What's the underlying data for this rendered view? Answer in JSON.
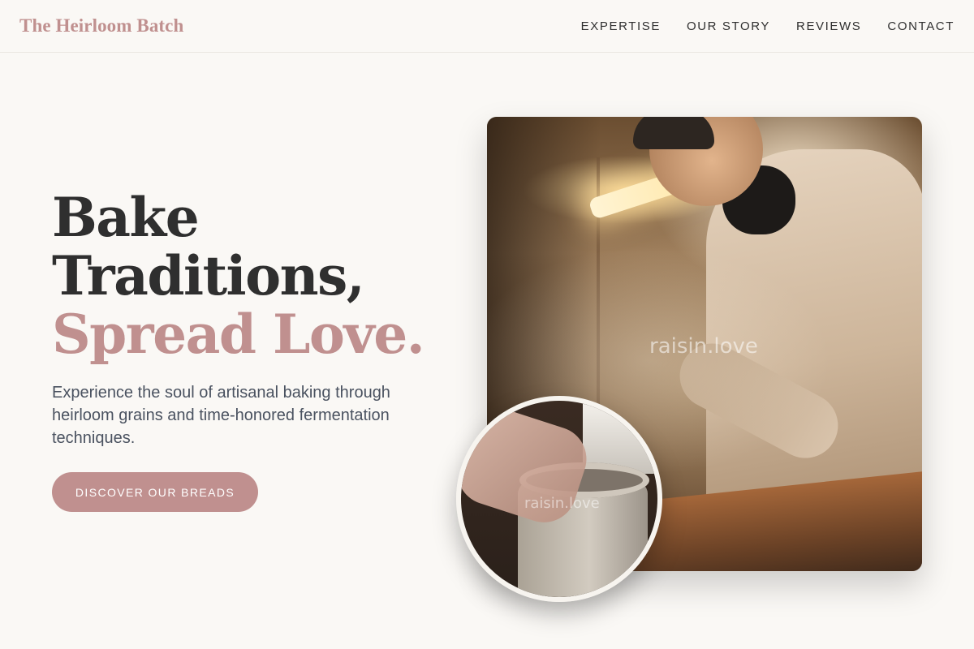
{
  "brand": {
    "name": "The Heirloom Batch"
  },
  "nav": {
    "items": [
      {
        "label": "EXPERTISE"
      },
      {
        "label": "OUR STORY"
      },
      {
        "label": "REVIEWS"
      },
      {
        "label": "CONTACT"
      }
    ]
  },
  "hero": {
    "headline_line1": "Bake",
    "headline_line2": "Traditions,",
    "headline_accent": "Spread Love.",
    "subtext": "Experience the soul of artisanal baking through heirloom grains and time-honored fermentation techniques.",
    "cta_label": "DISCOVER OUR BREADS"
  },
  "images": {
    "main_watermark": "raisin.love",
    "inset_watermark": "raisin.love"
  },
  "colors": {
    "accent": "#c0908f",
    "text_dark": "#2f2f2f",
    "background": "#faf8f5"
  }
}
